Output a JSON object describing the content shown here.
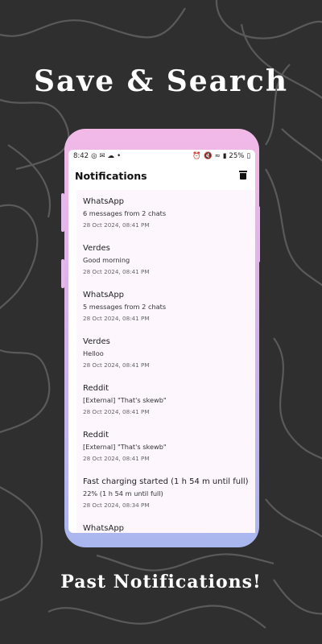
{
  "headline": "Save & Search",
  "footer": "Past Notifications!",
  "status_bar": {
    "time": "8:42",
    "battery": "25%"
  },
  "app": {
    "title": "Notifications"
  },
  "notifications": [
    {
      "app": "WhatsApp",
      "message": "6 messages from 2 chats",
      "time": "28 Oct 2024, 08:41 PM"
    },
    {
      "app": "Verdes",
      "message": "Good morning",
      "time": "28 Oct 2024, 08:41 PM"
    },
    {
      "app": "WhatsApp",
      "message": "5 messages from 2 chats",
      "time": "28 Oct 2024, 08:41 PM"
    },
    {
      "app": "Verdes",
      "message": "Helloo",
      "time": "28 Oct 2024, 08:41 PM"
    },
    {
      "app": "Reddit",
      "message": "[External] \"That's skewb\"",
      "time": "28 Oct 2024, 08:41 PM"
    },
    {
      "app": "Reddit",
      "message": "[External] \"That's skewb\"",
      "time": "28 Oct 2024, 08:41 PM"
    },
    {
      "app": "Fast charging started (1 h 54 m until full)",
      "message": "22% (1 h 54 m until full)",
      "time": "28 Oct 2024, 08:34 PM"
    },
    {
      "app": "WhatsApp",
      "message": "",
      "time": ""
    }
  ],
  "colors": {
    "background": "#2f2f2f",
    "phone_top": "#f2b9e7",
    "phone_bottom": "#a9b7ef",
    "list_bg": "#fdf6fd"
  }
}
